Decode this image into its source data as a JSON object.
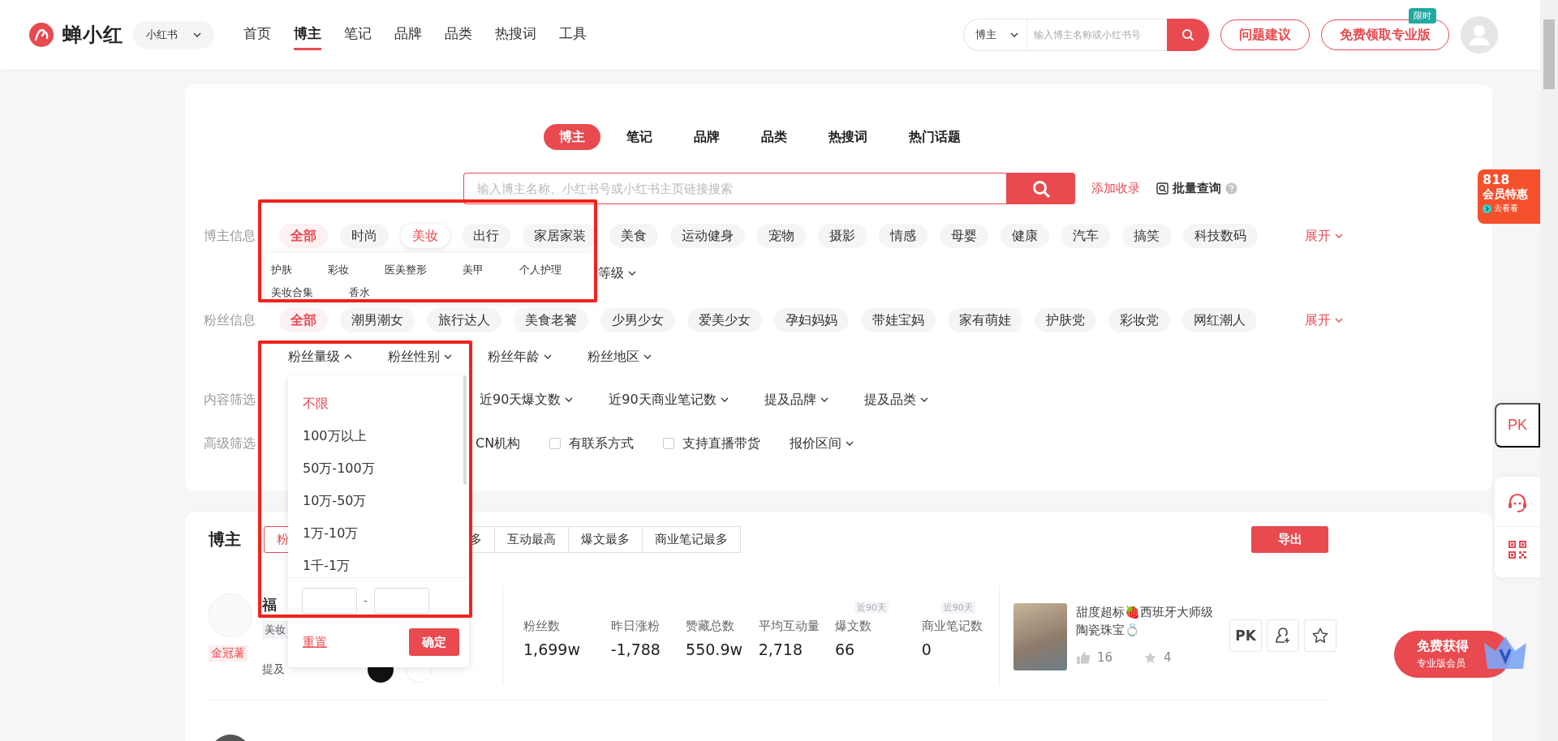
{
  "header": {
    "logo_text": "蝉小红",
    "platform": "小红书",
    "nav": [
      {
        "label": "首页",
        "selected": false
      },
      {
        "label": "博主",
        "selected": true
      },
      {
        "label": "笔记",
        "selected": false
      },
      {
        "label": "品牌",
        "selected": false
      },
      {
        "label": "品类",
        "selected": false
      },
      {
        "label": "热搜词",
        "selected": false
      },
      {
        "label": "工具",
        "selected": false
      }
    ],
    "search": {
      "scope": "博主",
      "placeholder": "输入博主名称或小红书号"
    },
    "buttons": [
      {
        "label": "问题建议"
      },
      {
        "label": "免费领取专业版",
        "badge": "限时"
      }
    ]
  },
  "filter_panel": {
    "tabs": [
      {
        "label": "博主",
        "selected": true
      },
      {
        "label": "笔记",
        "selected": false
      },
      {
        "label": "品牌",
        "selected": false
      },
      {
        "label": "品类",
        "selected": false
      },
      {
        "label": "热搜词",
        "selected": false
      },
      {
        "label": "热门话题",
        "selected": false
      }
    ],
    "search": {
      "placeholder": "输入博主名称、小红书号或小红书主页链接搜索"
    },
    "add_link": "添加收录",
    "batch_query": "批量查询",
    "blogger_info": {
      "label": "博主信息",
      "expand": "展开",
      "tags": [
        {
          "label": "全部",
          "selected": true,
          "expanded": false
        },
        {
          "label": "时尚",
          "selected": false,
          "expanded": false
        },
        {
          "label": "美妆",
          "selected": false,
          "expanded": true
        },
        {
          "label": "出行",
          "selected": false,
          "expanded": false
        },
        {
          "label": "家居家装",
          "selected": false,
          "expanded": false
        },
        {
          "label": "美食",
          "selected": false,
          "expanded": false
        },
        {
          "label": "运动健身",
          "selected": false,
          "expanded": false
        },
        {
          "label": "宠物",
          "selected": false,
          "expanded": false
        },
        {
          "label": "摄影",
          "selected": false,
          "expanded": false
        },
        {
          "label": "情感",
          "selected": false,
          "expanded": false
        },
        {
          "label": "母婴",
          "selected": false,
          "expanded": false
        },
        {
          "label": "健康",
          "selected": false,
          "expanded": false
        },
        {
          "label": "汽车",
          "selected": false,
          "expanded": false
        },
        {
          "label": "搞笑",
          "selected": false,
          "expanded": false
        },
        {
          "label": "科技数码",
          "selected": false,
          "expanded": false
        }
      ]
    },
    "blogger_level": {
      "dropdown": "等级"
    },
    "fan_info": {
      "label": "粉丝信息",
      "expand": "展开",
      "tags": [
        {
          "label": "全部",
          "selected": true
        },
        {
          "label": "潮男潮女",
          "selected": false
        },
        {
          "label": "旅行达人",
          "selected": false
        },
        {
          "label": "美食老饕",
          "selected": false
        },
        {
          "label": "少男少女",
          "selected": false
        },
        {
          "label": "爱美少女",
          "selected": false
        },
        {
          "label": "孕妇妈妈",
          "selected": false
        },
        {
          "label": "带娃宝妈",
          "selected": false
        },
        {
          "label": "家有萌娃",
          "selected": false
        },
        {
          "label": "护肤党",
          "selected": false
        },
        {
          "label": "彩妆党",
          "selected": false
        },
        {
          "label": "网红潮人",
          "selected": false
        }
      ]
    },
    "fan_dropdowns": [
      {
        "label": "粉丝量级",
        "expanded": true
      },
      {
        "label": "粉丝性别",
        "expanded": false
      },
      {
        "label": "粉丝年龄",
        "expanded": false
      },
      {
        "label": "粉丝地区",
        "expanded": false
      }
    ],
    "content_filter": {
      "label": "内容筛选",
      "dropdowns": [
        "近90天爆文数",
        "近90天商业笔记数",
        "提及品牌",
        "提及品类"
      ]
    },
    "advanced_filter": {
      "label": "高级筛选",
      "items": [
        {
          "kind": "text",
          "label": "CN机构"
        },
        {
          "kind": "checkbox",
          "label": "有联系方式",
          "checked": false
        },
        {
          "kind": "checkbox",
          "label": "支持直播带货",
          "checked": false
        },
        {
          "kind": "dropdown",
          "label": "报价区间"
        }
      ]
    }
  },
  "category_submenu": {
    "items": [
      "护肤",
      "彩妆",
      "医美整形",
      "美甲",
      "个人护理",
      "美妆合集",
      "香水"
    ]
  },
  "fan_size_menu": {
    "options": [
      {
        "label": "不限",
        "selected": true
      },
      {
        "label": "100万以上",
        "selected": false
      },
      {
        "label": "50万-100万",
        "selected": false
      },
      {
        "label": "10万-50万",
        "selected": false
      },
      {
        "label": "1万-10万",
        "selected": false
      },
      {
        "label": "1千-1万",
        "selected": false
      }
    ],
    "range_separator": "-",
    "reset": "重置",
    "confirm": "确定"
  },
  "results": {
    "title": "博主",
    "export": "导出",
    "sort_tabs": [
      {
        "label": "粉",
        "selected": true
      },
      {
        "label": "多",
        "selected": false
      },
      {
        "label": "互动最高",
        "selected": false
      },
      {
        "label": "爆文最多",
        "selected": false
      },
      {
        "label": "商业笔记最多",
        "selected": false
      }
    ],
    "blogger": {
      "name": "福",
      "category": "美妆",
      "badge": "金冠薯",
      "brands_label": "提及",
      "stats": [
        {
          "label": "粉丝数",
          "value": "1,699w"
        },
        {
          "label": "昨日涨粉",
          "value": "-1,788"
        },
        {
          "label": "赞藏总数",
          "value": "550.9w"
        },
        {
          "label": "平均互动量",
          "value": "2,718"
        },
        {
          "label": "爆文数",
          "value": "66",
          "period": "近90天"
        },
        {
          "label": "商业笔记数",
          "value": "0",
          "period": "近90天"
        }
      ],
      "note": {
        "title": "甜度超标🍓西班牙大师级陶瓷珠宝💍",
        "likes": "16",
        "collects": "4"
      },
      "pk": "PK"
    }
  },
  "side_panel": {
    "promo": {
      "title": "818",
      "subtitle": "会员特惠",
      "link": "去看看"
    },
    "pk": "PK",
    "member_promo": {
      "title": "免费获得",
      "subtitle": "专业版会员"
    }
  }
}
